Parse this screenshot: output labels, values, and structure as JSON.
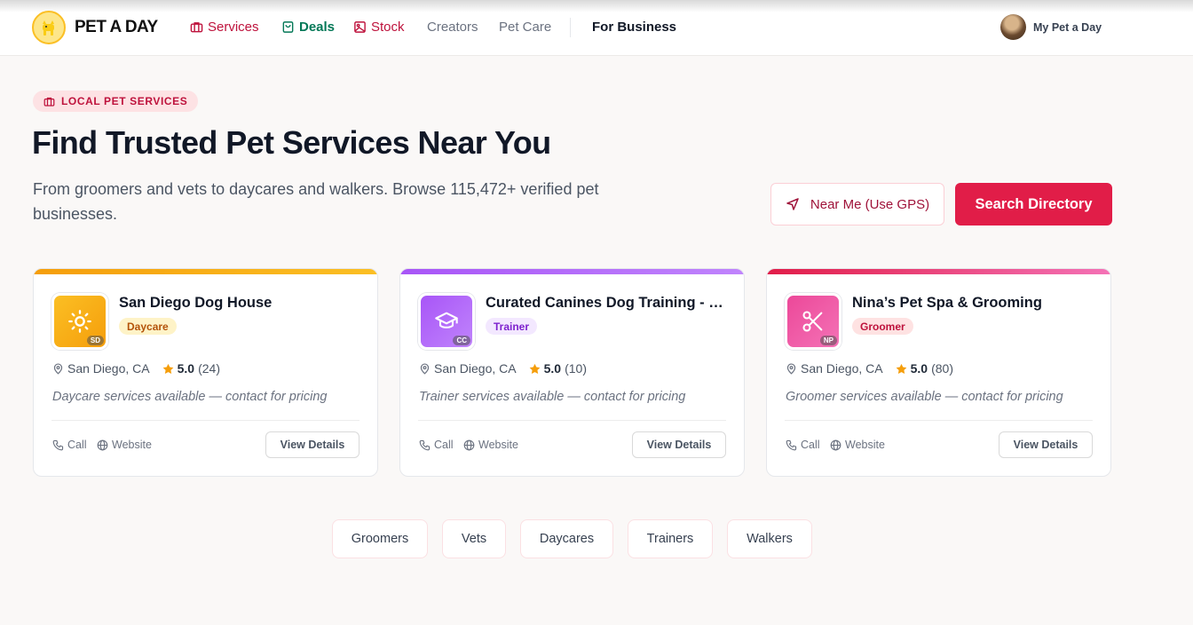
{
  "header": {
    "brand": "PET A DAY",
    "nav": [
      {
        "label": "Services",
        "icon": "briefcase-icon",
        "color": "#be123c"
      },
      {
        "label": "Deals",
        "icon": "shopping-bag-icon",
        "color": "#047857"
      },
      {
        "label": "Stock",
        "icon": "image-icon",
        "color": "#be123c"
      },
      {
        "label": "Creators",
        "color": "#6b7280"
      },
      {
        "label": "Pet Care",
        "color": "#6b7280"
      },
      {
        "label": "For Business",
        "color": "#111827"
      }
    ],
    "account_label": "My Pet a Day"
  },
  "hero": {
    "pill": "LOCAL PET SERVICES",
    "title": "Find Trusted Pet Services Near You",
    "subtitle": "From groomers and vets to daycares and walkers. Browse 115,472+ verified pet businesses.",
    "gps_button": "Near Me (Use GPS)",
    "search_button": "Search Directory"
  },
  "cards": [
    {
      "name": "San Diego Dog House",
      "initials": "SD",
      "tag": "Daycare",
      "icon": "sun-icon",
      "location": "San Diego, CA",
      "rating": "5.0",
      "reviews": "(24)",
      "description": "Daycare services available — contact for pricing",
      "call": "Call",
      "website": "Website",
      "details": "View Details",
      "accent": "#f59e0b"
    },
    {
      "name": "Curated Canines Dog Training - …",
      "initials": "CC",
      "tag": "Trainer",
      "icon": "graduation-cap-icon",
      "location": "San Diego, CA",
      "rating": "5.0",
      "reviews": "(10)",
      "description": "Trainer services available — contact for pricing",
      "call": "Call",
      "website": "Website",
      "details": "View Details",
      "accent": "#a855f7"
    },
    {
      "name": "Nina’s Pet Spa & Grooming",
      "initials": "NP",
      "tag": "Groomer",
      "icon": "scissors-icon",
      "location": "San Diego, CA",
      "rating": "5.0",
      "reviews": "(80)",
      "description": "Groomer services available — contact for pricing",
      "call": "Call",
      "website": "Website",
      "details": "View Details",
      "accent": "#ec4899"
    }
  ],
  "categories": [
    "Groomers",
    "Vets",
    "Daycares",
    "Trainers",
    "Walkers"
  ]
}
